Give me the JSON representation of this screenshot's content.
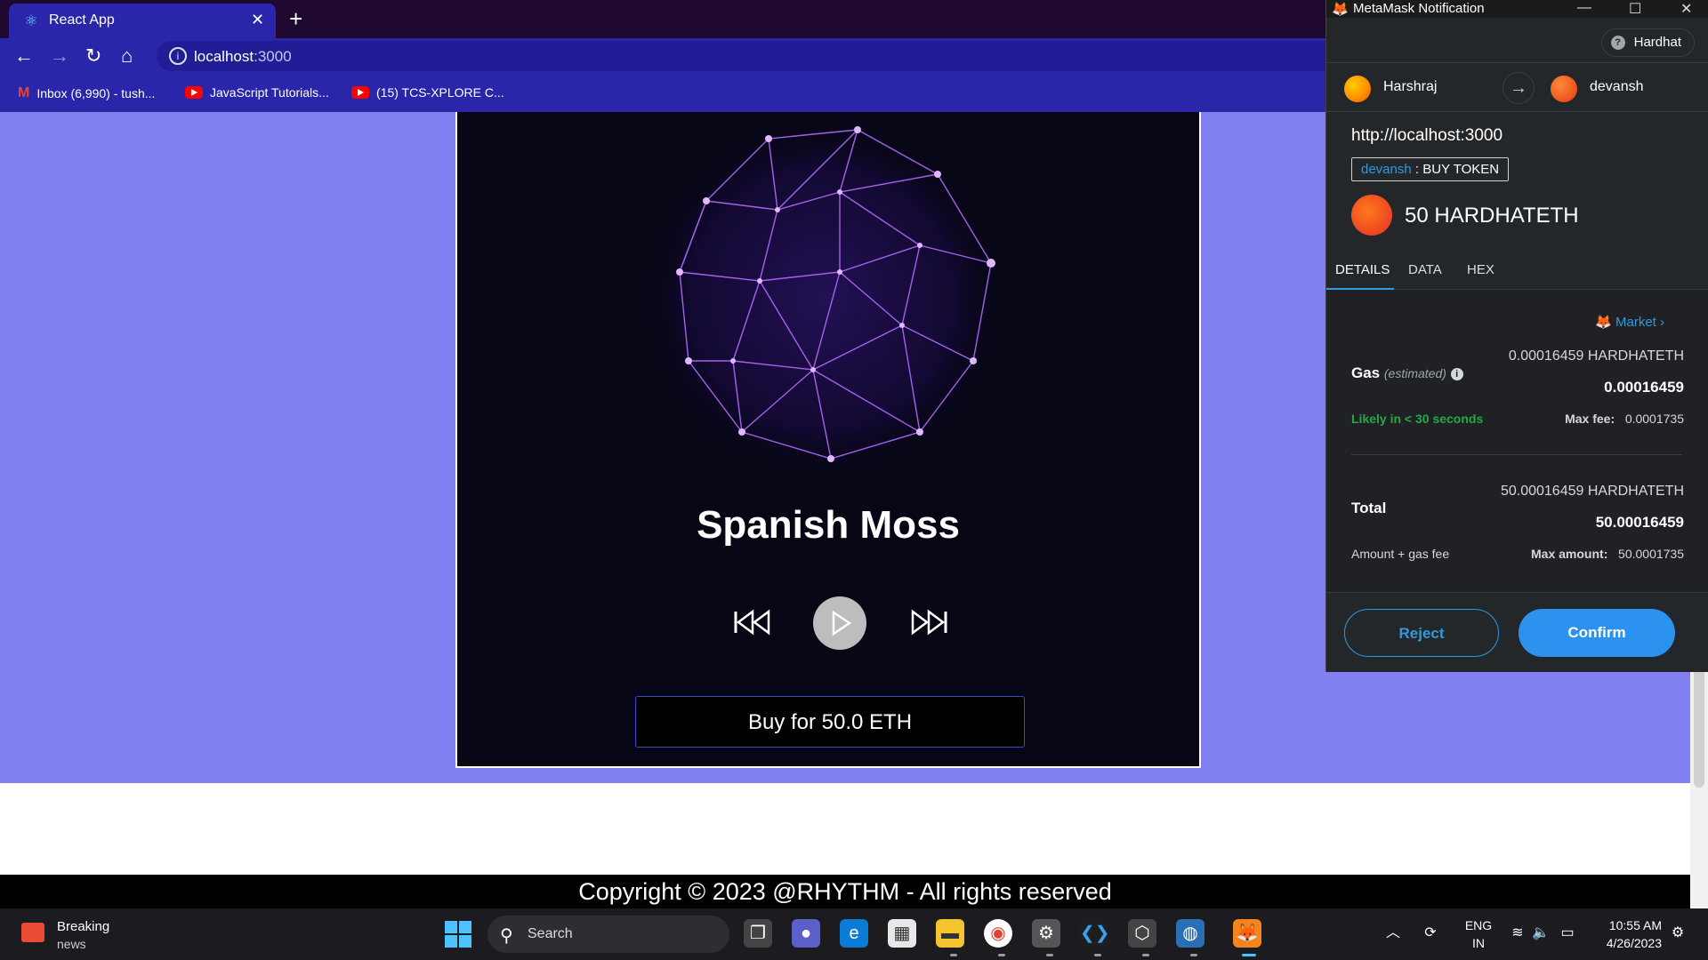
{
  "browser": {
    "tab_title": "React App",
    "url_host": "localhost",
    "url_port": ":3000",
    "bookmarks": [
      {
        "label": "Inbox (6,990) - tush..."
      },
      {
        "label": "JavaScript Tutorials..."
      },
      {
        "label": "(15) TCS-XPLORE C..."
      }
    ]
  },
  "player": {
    "song_title": "Spanish Moss",
    "buy_label": "Buy for 50.0 ETH"
  },
  "footer": {
    "copyright": "Copyright © 2023 @RHYTHM - All rights reserved"
  },
  "metamask": {
    "window_title": "MetaMask Notification",
    "network": "Hardhat",
    "from_account": "Harshraj",
    "to_account": "devansh",
    "origin": "http://localhost:3000",
    "method_account": "devansh",
    "method_separator": " : ",
    "method_name": "BUY TOKEN",
    "amount": "50 HARDHATETH",
    "tabs": [
      "DETAILS",
      "DATA",
      "HEX"
    ],
    "market_label": "Market",
    "gas_label": "Gas",
    "gas_estimated": "(estimated)",
    "gas_value_full": "0.00016459 HARDHATETH",
    "gas_value": "0.00016459",
    "likely": "Likely in < 30 seconds",
    "max_fee_label": "Max fee:",
    "max_fee_value": "0.0001735",
    "total_label": "Total",
    "total_value_full": "50.00016459 HARDHATETH",
    "total_value": "50.00016459",
    "amount_gas_label": "Amount + gas fee",
    "max_amount_label": "Max amount:",
    "max_amount_value": "50.0001735",
    "reject_label": "Reject",
    "confirm_label": "Confirm"
  },
  "taskbar": {
    "news_line1": "Breaking",
    "news_line2": "news",
    "search_label": "Search",
    "lang_line1": "ENG",
    "lang_line2": "IN",
    "time": "10:55 AM",
    "date": "4/26/2023"
  },
  "colors": {
    "page_background": "#8080f0",
    "browser_frame": "#2a26a9",
    "metamask_accent": "#2f9ae0",
    "likely_green": "#28a745"
  }
}
